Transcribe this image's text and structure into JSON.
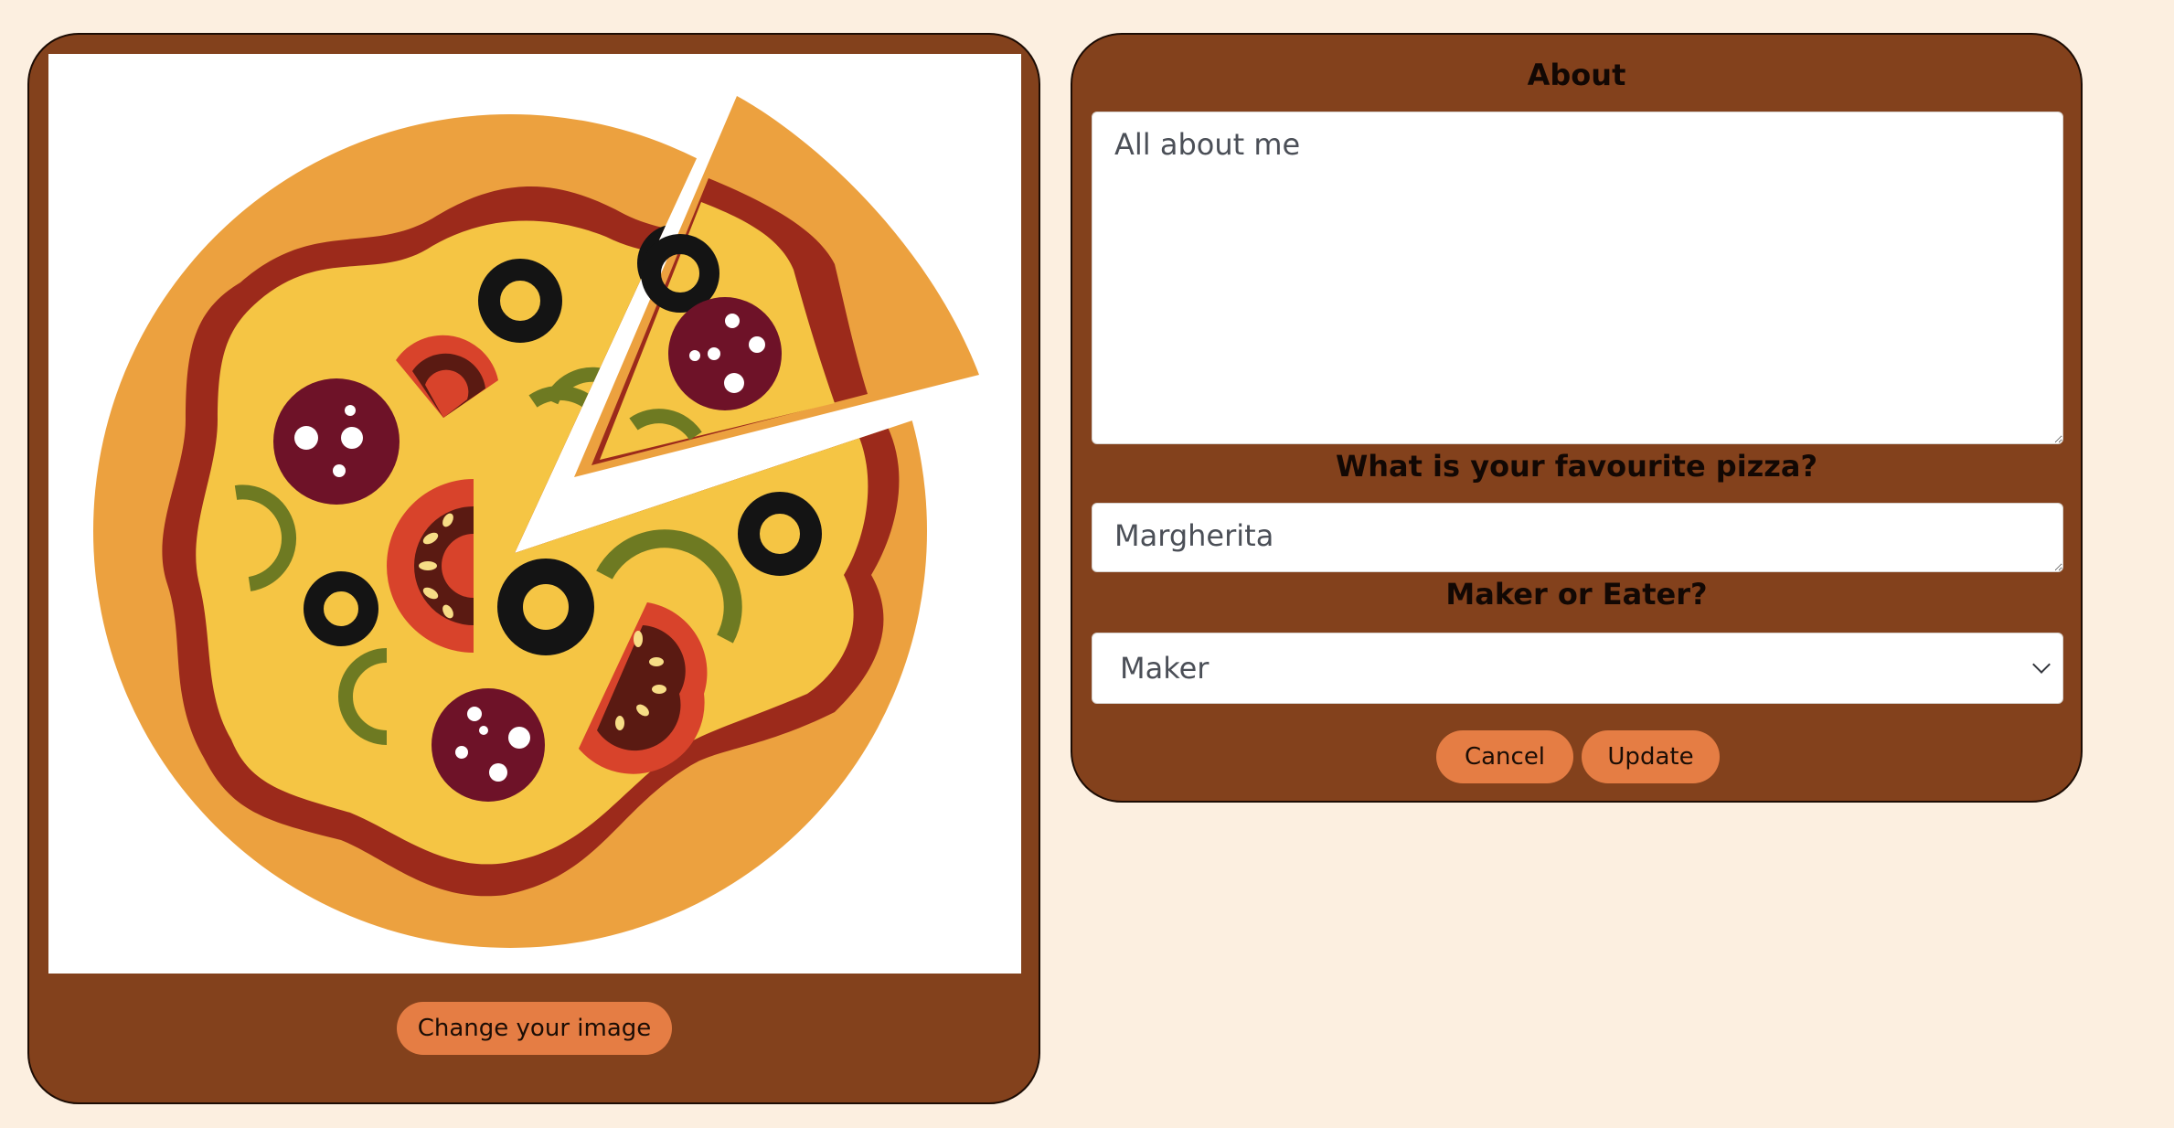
{
  "image_card": {
    "image_subject": "pizza-illustration",
    "change_image_label": "Change your image"
  },
  "profile_form": {
    "about_heading": "About",
    "about_value": "All about me",
    "pizza_heading": "What is your favourite pizza?",
    "pizza_value": "Margherita",
    "role_heading": "Maker or Eater?",
    "role_selected": "Maker",
    "cancel_label": "Cancel",
    "update_label": "Update"
  },
  "colors": {
    "page_background": "#fcefe0",
    "card_background": "#83411c",
    "button_accent": "#e57d44",
    "crust": "#eca13f",
    "sauce": "#9c2a1b",
    "cheese": "#f5c544",
    "pepperoni": "#6e1228",
    "olive": "#141414",
    "green_pepper": "#6e7a22",
    "tomato": "#d8432b"
  }
}
